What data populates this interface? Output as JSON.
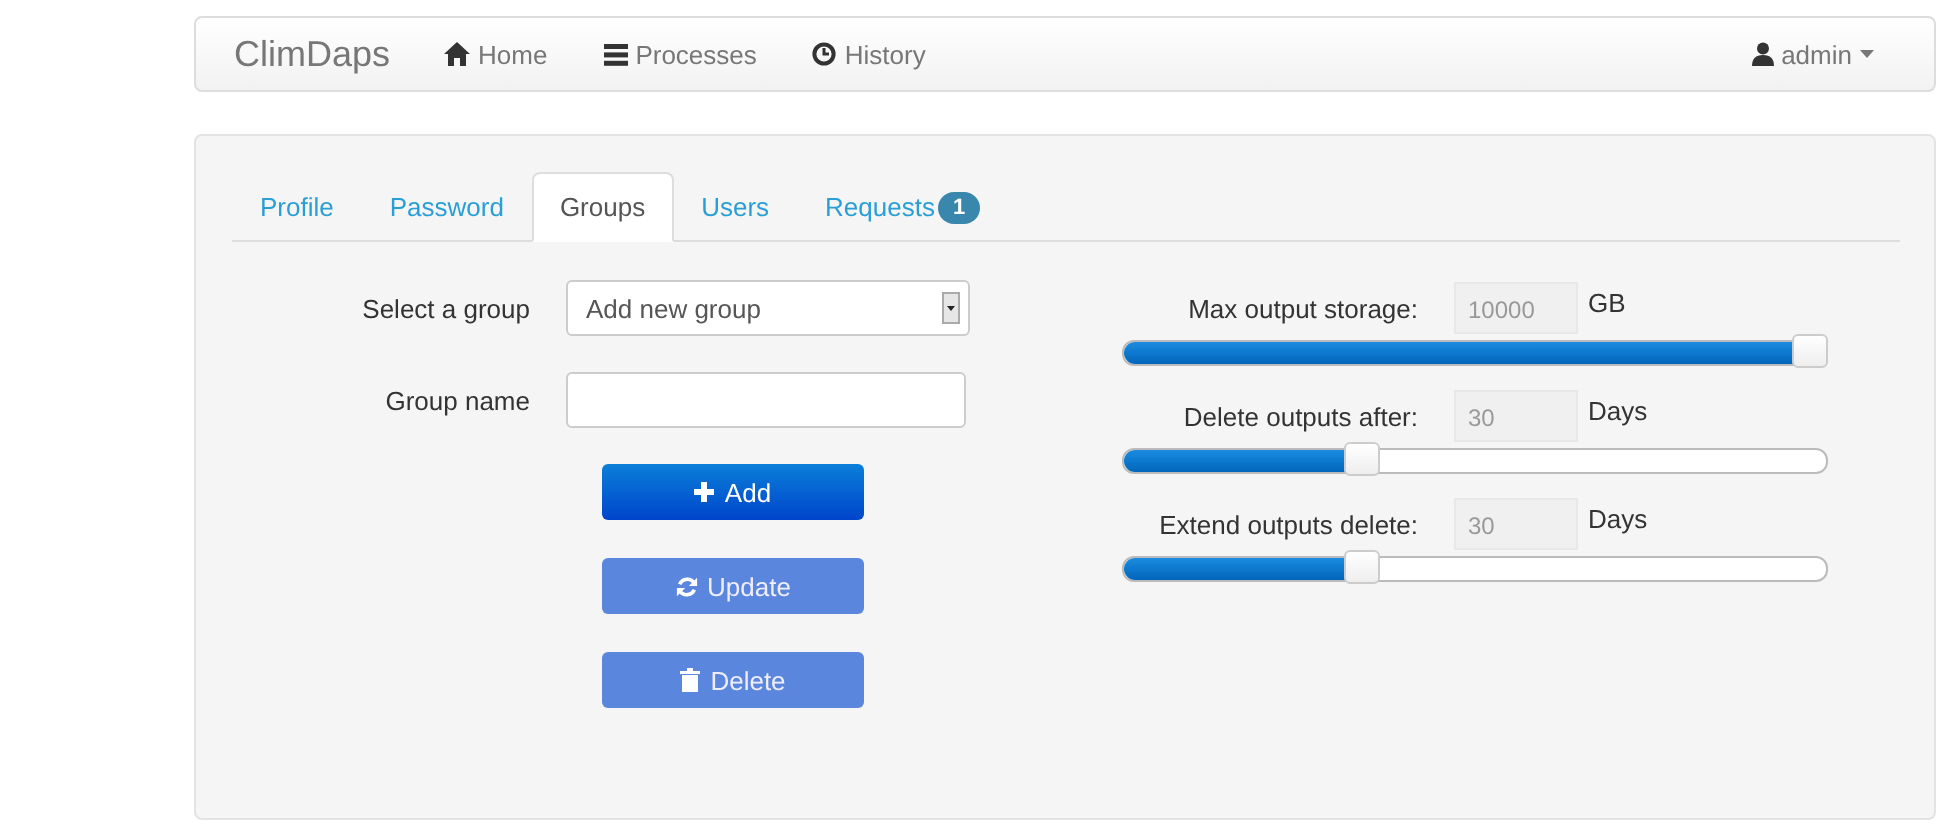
{
  "navbar": {
    "brand": "ClimDaps",
    "links": [
      {
        "label": "Home"
      },
      {
        "label": "Processes"
      },
      {
        "label": "History"
      }
    ],
    "user": "admin"
  },
  "tabs": [
    {
      "label": "Profile",
      "selected": false
    },
    {
      "label": "Password",
      "selected": false
    },
    {
      "label": "Groups",
      "selected": true
    },
    {
      "label": "Users",
      "selected": false
    },
    {
      "label": "Requests",
      "selected": false,
      "badge": "1"
    }
  ],
  "form": {
    "select_label": "Select a group",
    "select_value": "Add new group",
    "name_label": "Group name",
    "buttons": [
      {
        "label": "Add",
        "disabled": false
      },
      {
        "label": "Update",
        "disabled": true
      },
      {
        "label": "Delete",
        "disabled": true
      }
    ]
  },
  "sliders": [
    {
      "label": "Max output storage:",
      "value": "10000",
      "unit": "GB",
      "level": 1.0
    },
    {
      "label": "Delete outputs after:",
      "value": "30",
      "unit": "Days",
      "level": 0.33
    },
    {
      "label": "Extend outputs delete:",
      "value": "30",
      "unit": "Days",
      "level": 0.33
    }
  ]
}
